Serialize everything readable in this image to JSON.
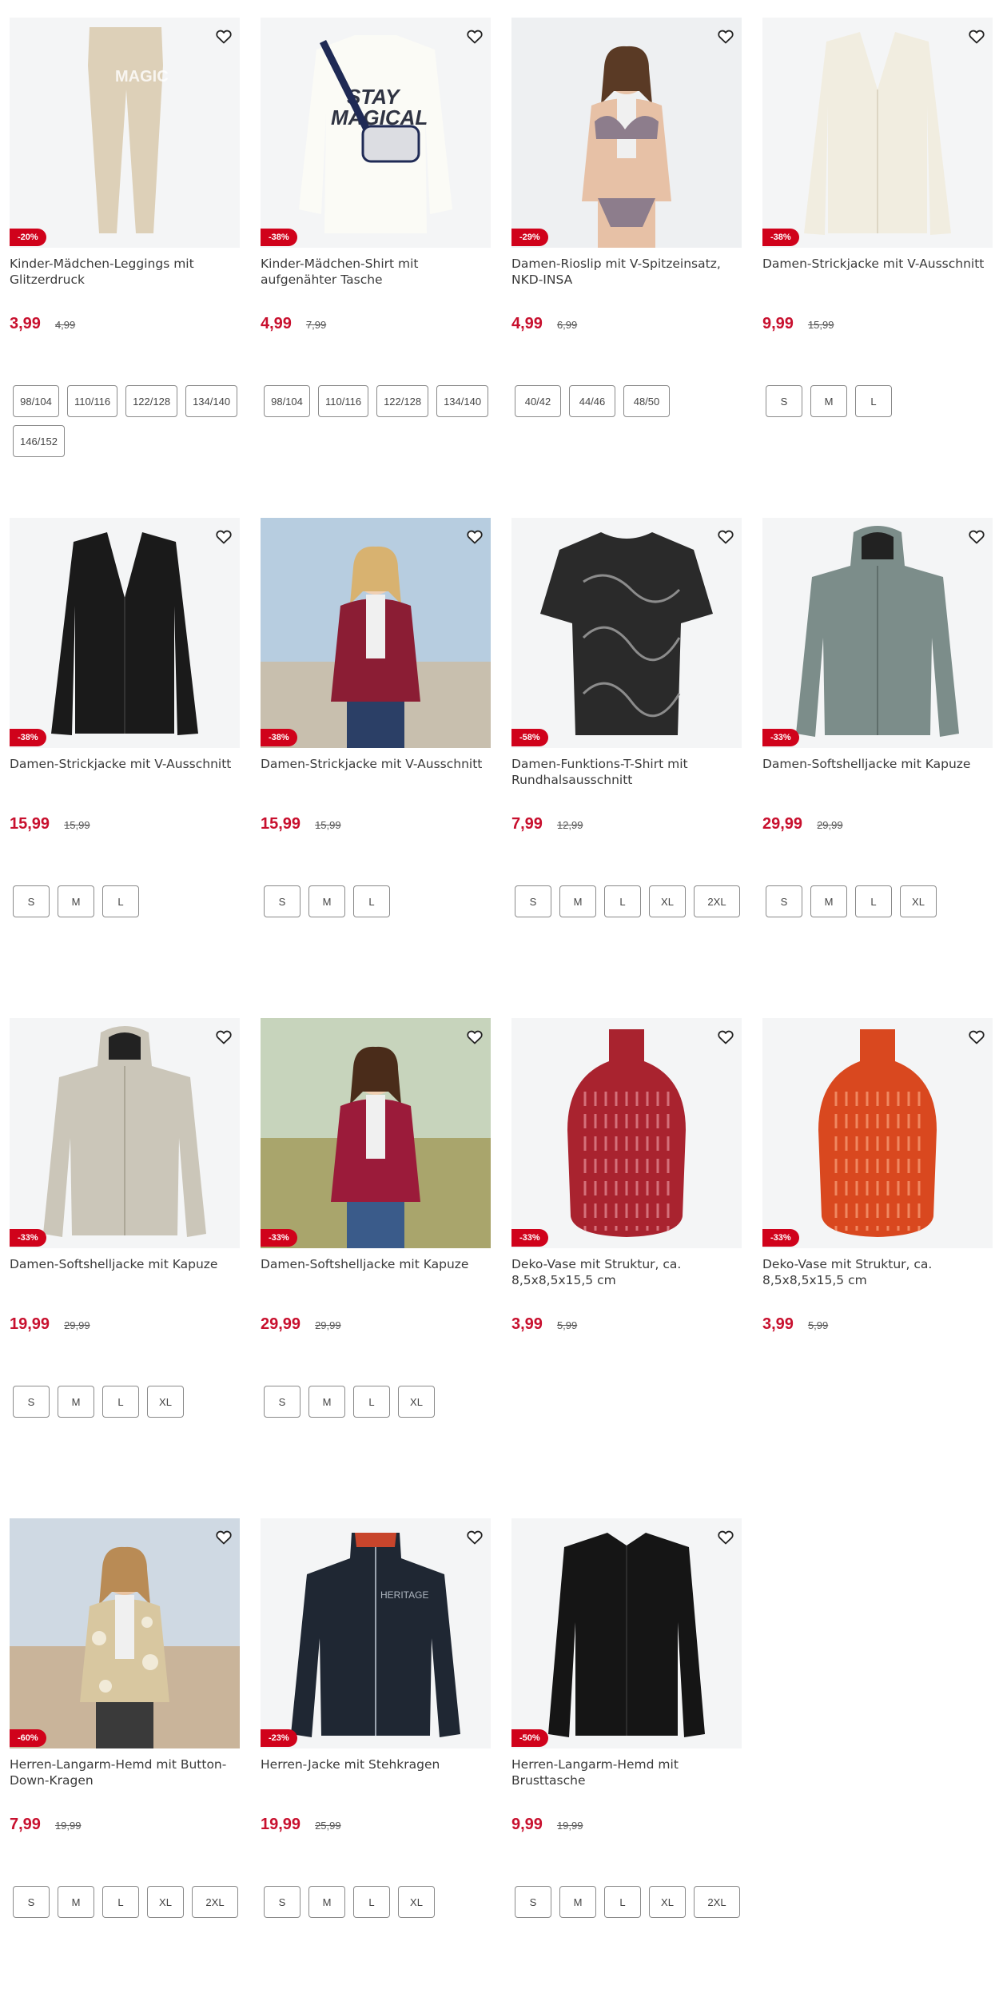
{
  "products": [
    {
      "title": "Kinder-Mädchen-Leggings mit Glitzerdruck",
      "badge": "-20%",
      "price": "3,99",
      "old_price": "4,99",
      "sizes": [
        "98/104",
        "110/116",
        "122/128",
        "134/140",
        "146/152"
      ],
      "image": "leggings"
    },
    {
      "title": "Kinder-Mädchen-Shirt mit aufgenähter Tasche",
      "badge": "-38%",
      "price": "4,99",
      "old_price": "7,99",
      "sizes": [
        "98/104",
        "110/116",
        "122/128",
        "134/140"
      ],
      "image": "shirt"
    },
    {
      "title": "Damen-Rioslip mit V-Spitzeinsatz, NKD-INSA",
      "badge": "-29%",
      "price": "4,99",
      "old_price": "6,99",
      "sizes": [
        "40/42",
        "44/46",
        "48/50"
      ],
      "image": "lingerie"
    },
    {
      "title": "Damen-Strickjacke mit V-Ausschnitt",
      "badge": "-38%",
      "price": "9,99",
      "old_price": "15,99",
      "sizes": [
        "S",
        "M",
        "L"
      ],
      "image": "cardigan-cream"
    },
    {
      "title": "Damen-Strickjacke mit V-Ausschnitt",
      "badge": "-38%",
      "price": "15,99",
      "old_price": "15,99",
      "sizes": [
        "S",
        "M",
        "L"
      ],
      "image": "cardigan-black"
    },
    {
      "title": "Damen-Strickjacke mit V-Ausschnitt",
      "badge": "-38%",
      "price": "15,99",
      "old_price": "15,99",
      "sizes": [
        "S",
        "M",
        "L"
      ],
      "image": "cardigan-red-model"
    },
    {
      "title": "Damen-Funktions-T-Shirt mit Rundhalsausschnitt",
      "badge": "-58%",
      "price": "7,99",
      "old_price": "12,99",
      "sizes": [
        "S",
        "M",
        "L",
        "XL",
        "2XL"
      ],
      "image": "tshirt-pattern"
    },
    {
      "title": "Damen-Softshelljacke mit Kapuze",
      "badge": "-33%",
      "price": "29,99",
      "old_price": "29,99",
      "sizes": [
        "S",
        "M",
        "L",
        "XL"
      ],
      "image": "jacket-grey"
    },
    {
      "title": "Damen-Softshelljacke mit Kapuze",
      "badge": "-33%",
      "price": "19,99",
      "old_price": "29,99",
      "sizes": [
        "S",
        "M",
        "L",
        "XL"
      ],
      "image": "jacket-beige"
    },
    {
      "title": "Damen-Softshelljacke mit Kapuze",
      "badge": "-33%",
      "price": "29,99",
      "old_price": "29,99",
      "sizes": [
        "S",
        "M",
        "L",
        "XL"
      ],
      "image": "jacket-red-model"
    },
    {
      "title": "Deko-Vase mit Struktur, ca. 8,5x8,5x15,5 cm",
      "badge": "-33%",
      "price": "3,99",
      "old_price": "5,99",
      "sizes": [],
      "image": "vase-red"
    },
    {
      "title": "Deko-Vase mit Struktur, ca. 8,5x8,5x15,5 cm",
      "badge": "-33%",
      "price": "3,99",
      "old_price": "5,99",
      "sizes": [],
      "image": "vase-orange"
    },
    {
      "title": "Herren-Langarm-Hemd mit Button-Down-Kragen",
      "badge": "-60%",
      "price": "7,99",
      "old_price": "19,99",
      "sizes": [
        "S",
        "M",
        "L",
        "XL",
        "2XL"
      ],
      "image": "shirt-man-model"
    },
    {
      "title": "Herren-Jacke mit Stehkragen",
      "badge": "-23%",
      "price": "19,99",
      "old_price": "25,99",
      "sizes": [
        "S",
        "M",
        "L",
        "XL"
      ],
      "image": "jacket-navy"
    },
    {
      "title": "Herren-Langarm-Hemd mit Brusttasche",
      "badge": "-50%",
      "price": "9,99",
      "old_price": "19,99",
      "sizes": [
        "S",
        "M",
        "L",
        "XL",
        "2XL"
      ],
      "image": "shirt-black"
    }
  ],
  "colors": {
    "accent": "#c8102e",
    "badge": "#d0021b",
    "image_bg": "#f4f5f6"
  }
}
